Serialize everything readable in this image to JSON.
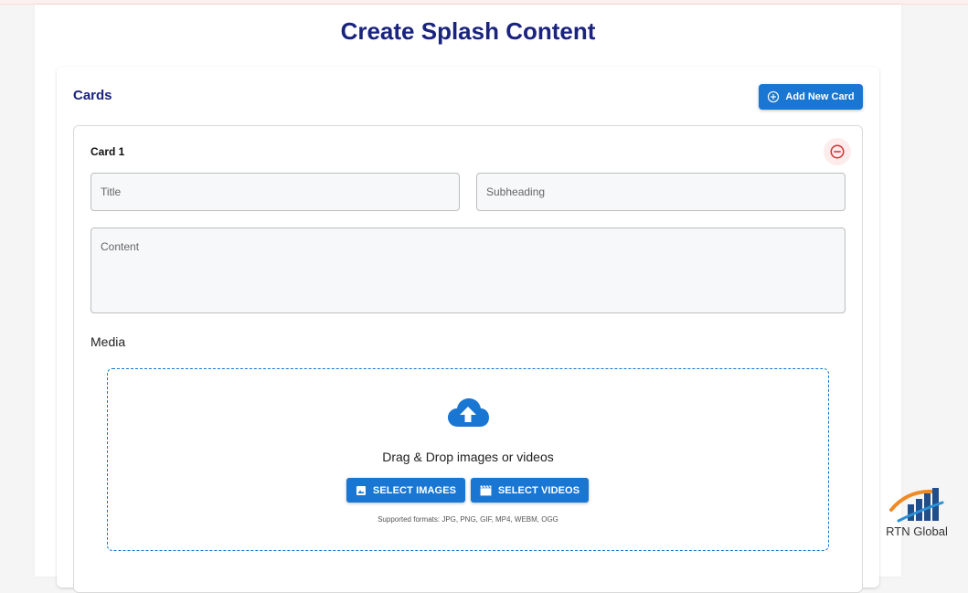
{
  "header": {
    "title": "Create Splash Content"
  },
  "cards_section": {
    "heading": "Cards",
    "add_button_label": "Add New Card",
    "add_button_icon": "plus-circle-icon"
  },
  "card": {
    "title": "Card 1",
    "remove_icon": "minus-circle-icon",
    "fields": {
      "title_placeholder": "Title",
      "subheading_placeholder": "Subheading",
      "content_placeholder": "Content"
    },
    "media": {
      "label": "Media",
      "upload_icon": "cloud-upload-icon",
      "dropzone_text": "Drag & Drop images or videos",
      "select_images_label": "SELECT IMAGES",
      "select_videos_label": "SELECT VIDEOS",
      "supported_formats": "Supported formats: JPG, PNG, GIF, MP4, WEBM, OGG"
    }
  },
  "logo": {
    "text": "RTN Global"
  },
  "colors": {
    "primary": "#1976d2",
    "heading": "#1a237e",
    "danger": "#d32f2f"
  }
}
